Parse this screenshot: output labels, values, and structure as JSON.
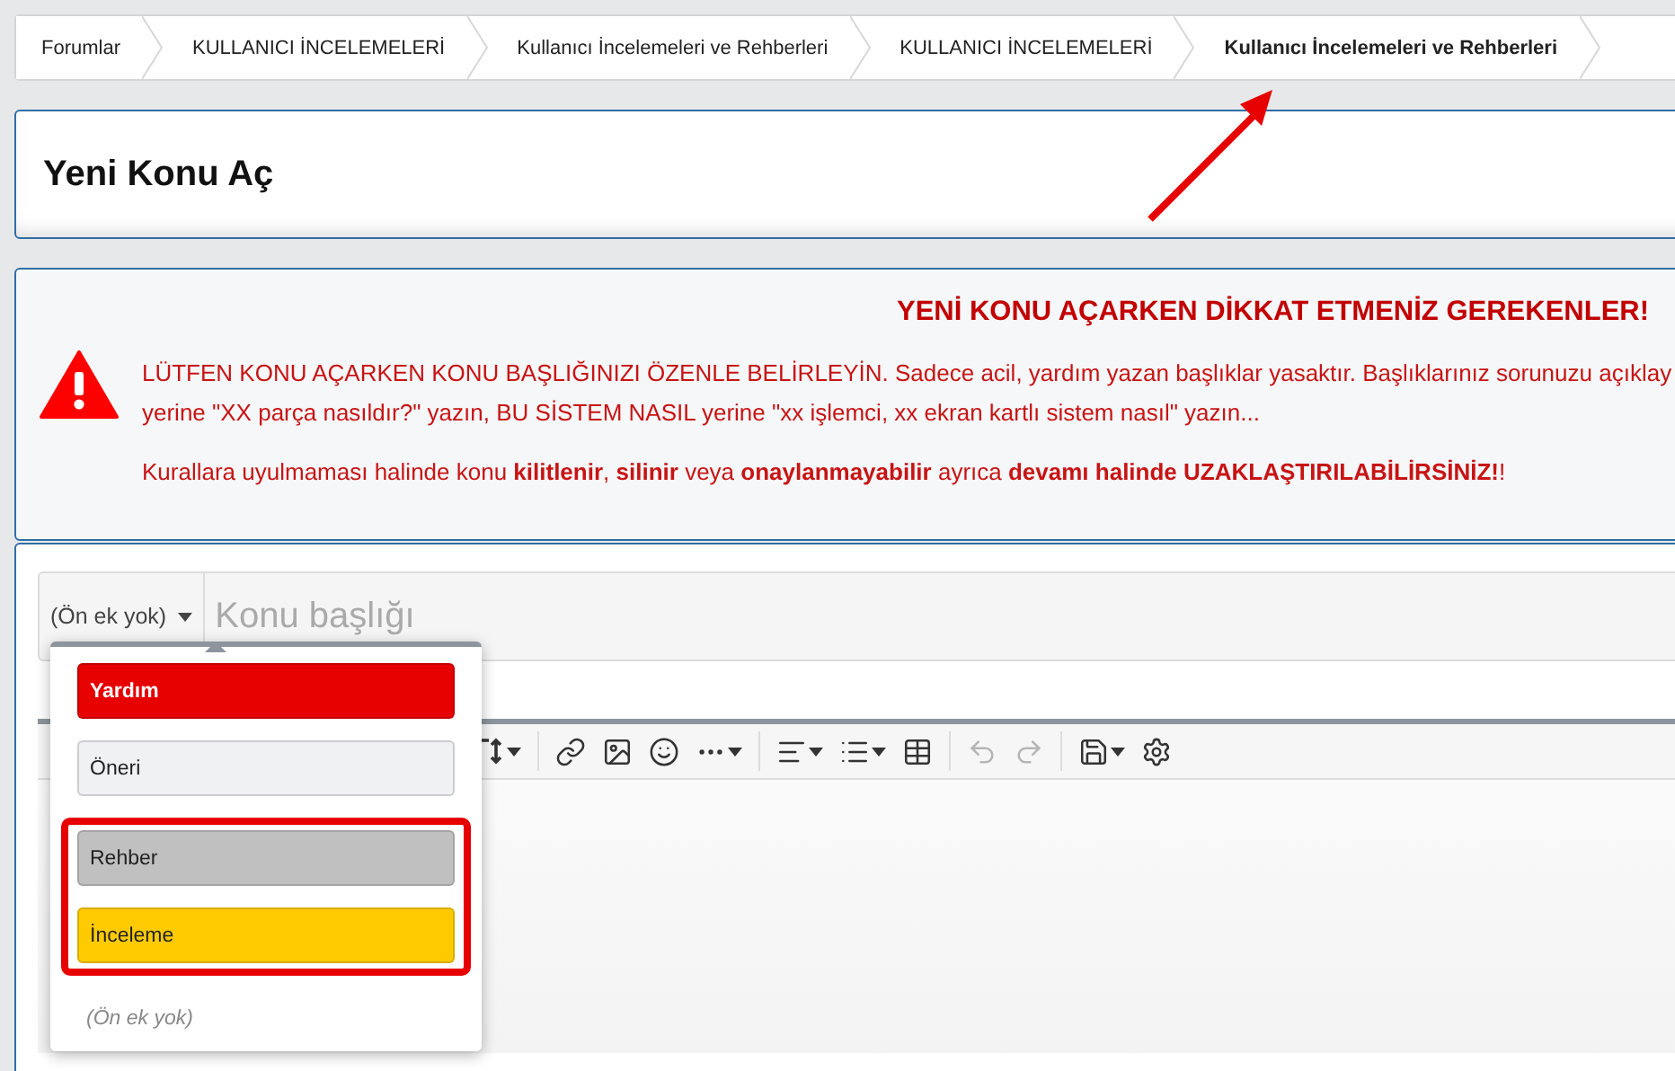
{
  "breadcrumbs": [
    {
      "label": "Forumlar",
      "current": false
    },
    {
      "label": "KULLANICI İNCELEMELERİ",
      "current": false
    },
    {
      "label": "Kullanıcı İncelemeleri ve Rehberleri",
      "current": false
    },
    {
      "label": "KULLANICI İNCELEMELERİ",
      "current": false
    },
    {
      "label": "Kullanıcı İncelemeleri ve Rehberleri",
      "current": true
    }
  ],
  "page_title": "Yeni Konu Aç",
  "notice": {
    "heading": "YENİ KONU AÇARKEN DİKKAT ETMENİZ GEREKENLER!",
    "lines": [
      "LÜTFEN KONU AÇARKEN KONU BAŞLIĞINIZI ÖZENLE BELİRLEYİN. Sadece acil, yardım yazan başlıklar yasaktır. Başlıklarınız sorunuzu açıklay",
      "yerine \"XX parça nasıldır?\" yazın, BU SİSTEM NASIL yerine \"xx işlemci, xx ekran kartlı sistem nasıl\" yazın..."
    ],
    "warning": "Kurallara uyulmaması halinde konu **kilitlenir**, **silinir** veya **onaylanmayabilir** ayrıca **devamı halinde UZAKLAŞTIRILABİLİRSİNİZ!**!"
  },
  "prefix_button": "(Ön ek yok)",
  "title_field": {
    "placeholder": "Konu başlığı"
  },
  "prefix_menu": {
    "items": [
      {
        "label": "Yardım",
        "color": "#e60000",
        "highlighted": false
      },
      {
        "label": "Öneri",
        "color": "#f0f1f3",
        "highlighted": false
      },
      {
        "label": "Rehber",
        "color": "#c0c0c0",
        "highlighted": true
      },
      {
        "label": "İnceleme",
        "color": "#ffcb00",
        "highlighted": true
      }
    ],
    "none_option": "(Ön ek yok)"
  },
  "toolbar": [
    {
      "kind": "textsize",
      "caret": true,
      "disabled": false
    },
    {
      "kind": "sep"
    },
    {
      "kind": "link",
      "caret": false,
      "disabled": false
    },
    {
      "kind": "image",
      "caret": false,
      "disabled": false
    },
    {
      "kind": "smile",
      "caret": false,
      "disabled": false
    },
    {
      "kind": "more",
      "caret": true,
      "disabled": false
    },
    {
      "kind": "sep"
    },
    {
      "kind": "align",
      "caret": true,
      "disabled": false
    },
    {
      "kind": "list",
      "caret": true,
      "disabled": false
    },
    {
      "kind": "table",
      "caret": false,
      "disabled": false
    },
    {
      "kind": "sep"
    },
    {
      "kind": "undo",
      "caret": false,
      "disabled": true
    },
    {
      "kind": "redo",
      "caret": false,
      "disabled": true
    },
    {
      "kind": "sep"
    },
    {
      "kind": "save",
      "caret": true,
      "disabled": false
    },
    {
      "kind": "settings",
      "caret": false,
      "disabled": false
    }
  ],
  "annotation": {
    "kind": "arrow"
  }
}
